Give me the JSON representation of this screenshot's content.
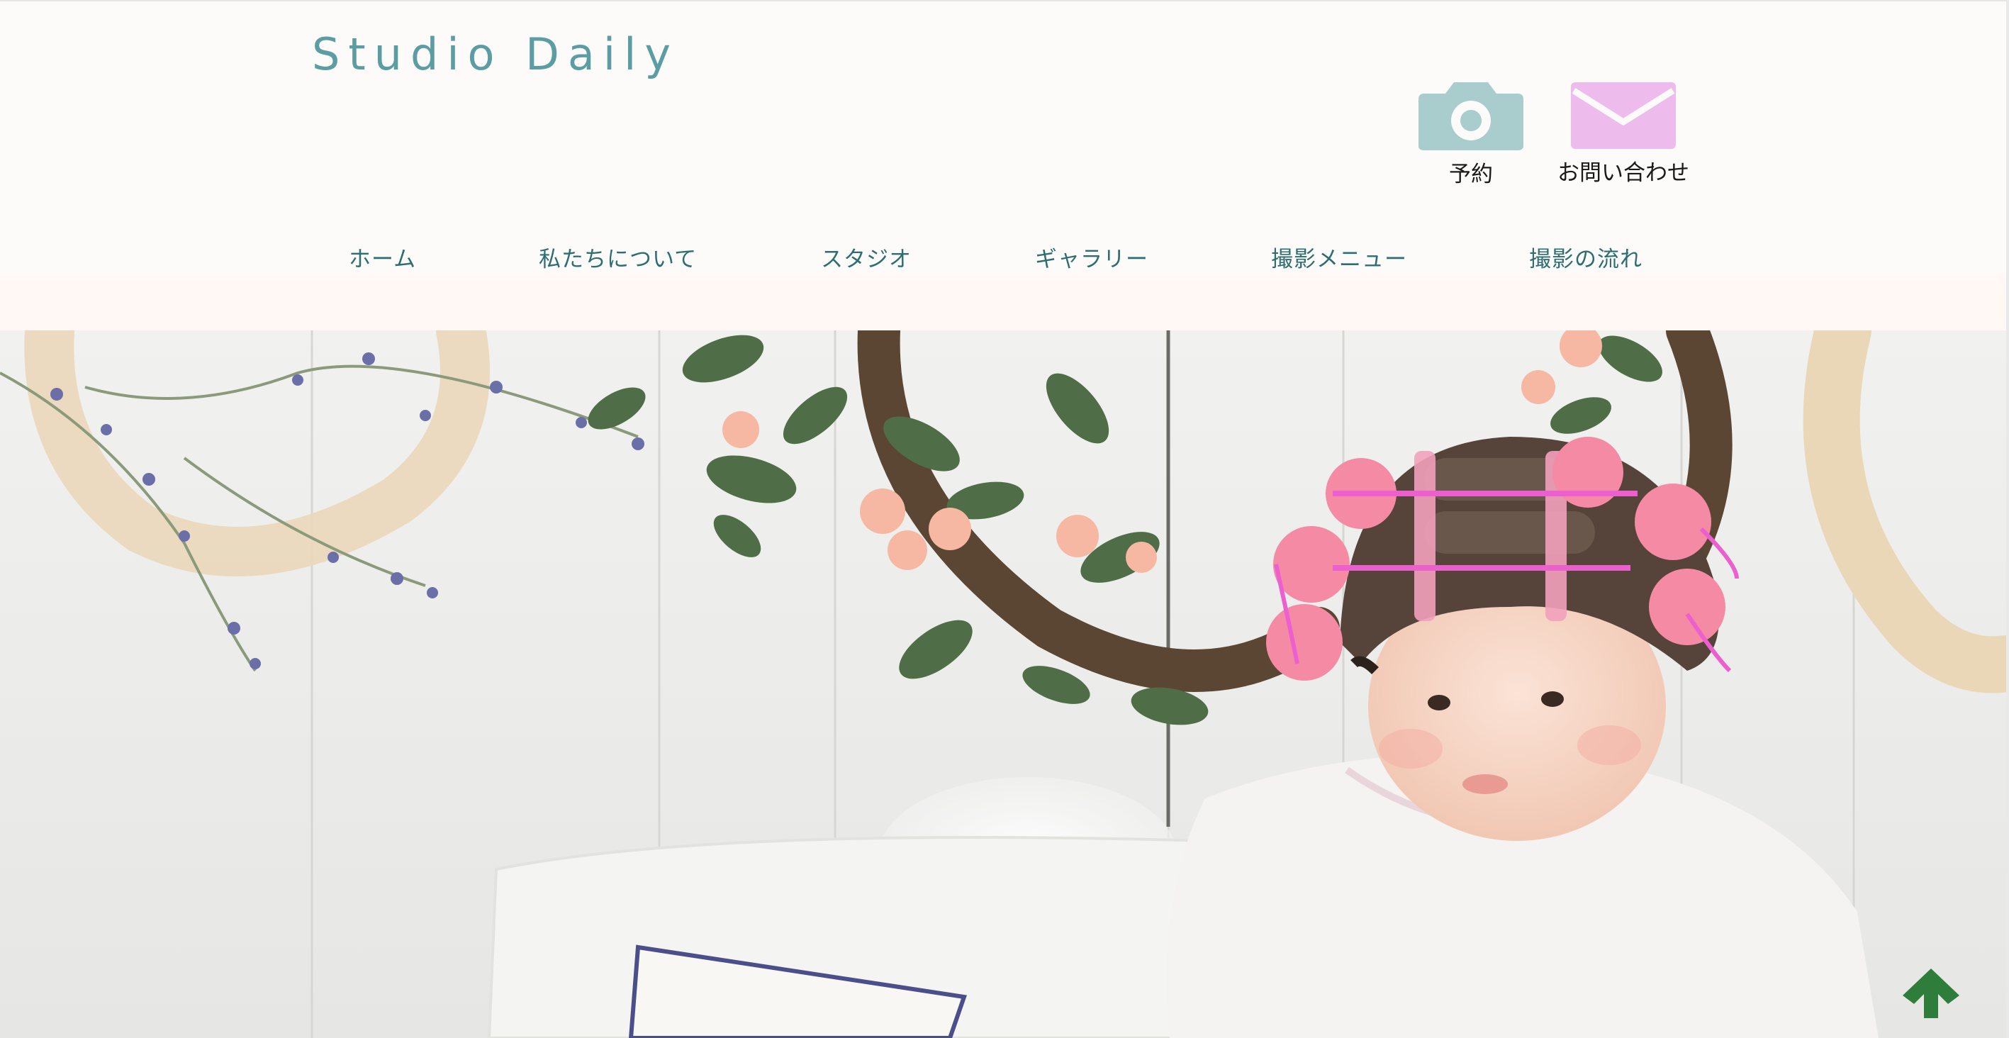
{
  "site": {
    "logo_text": "Studio Daily"
  },
  "header_actions": {
    "reserve": {
      "label": "予約",
      "icon": "camera-icon",
      "color": "#a9cccc"
    },
    "contact": {
      "label": "お問い合わせ",
      "icon": "mail-icon",
      "color": "#eebcec"
    }
  },
  "nav": {
    "items": [
      {
        "label": "ホーム"
      },
      {
        "label": "私たちについて"
      },
      {
        "label": "スタジオ"
      },
      {
        "label": "ギャラリー"
      },
      {
        "label": "撮影メニュー"
      },
      {
        "label": "撮影の流れ"
      }
    ]
  },
  "hero": {
    "image_subject": "baby-in-hair-rollers-photo"
  },
  "back_to_top": {
    "icon": "arrow-up-icon",
    "color": "#2f7d3a"
  },
  "colors": {
    "logo": "#5c9da3",
    "nav_text": "#2e6d72",
    "header_bg": "#fcfbfa"
  }
}
